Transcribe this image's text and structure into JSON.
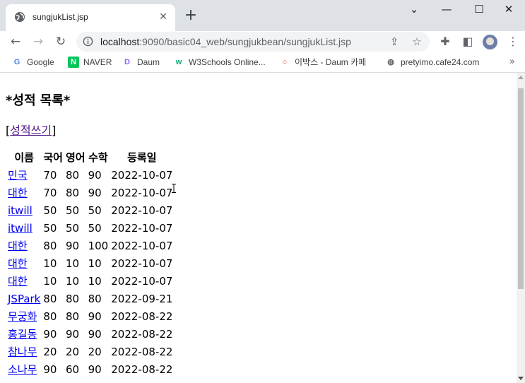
{
  "tab": {
    "title": "sungjukList.jsp",
    "close": "✕"
  },
  "new_tab": "+",
  "window_controls": {
    "minimize": "⌄",
    "restore": "—",
    "maximize": "☐",
    "close": "✕"
  },
  "omnibox": {
    "host": "localhost",
    "path": ":9090/basic04_web/sungjukbean/sungjukList.jsp"
  },
  "bookmarks": [
    {
      "label": "Google",
      "icon": "G",
      "color": "#4285f4"
    },
    {
      "label": "NAVER",
      "icon": "N",
      "color": "#03c75a"
    },
    {
      "label": "Daum",
      "icon": "D",
      "color": "#8a63ff"
    },
    {
      "label": "W3Schools Online...",
      "icon": "w",
      "color": "#04aa6d"
    },
    {
      "label": "이박스 - Daum 카페",
      "icon": "○",
      "color": "#e53935"
    },
    {
      "label": "pretyimo.cafe24.com",
      "icon": "◍",
      "color": "#5f6368"
    }
  ],
  "bookmarks_more": "»",
  "page": {
    "heading": "*성적 목록*",
    "write_link": {
      "open": "[",
      "label": "성적쓰기",
      "close": "]"
    },
    "columns": [
      "이름",
      "국어",
      "영어",
      "수학",
      "등록일"
    ],
    "rows": [
      [
        "민국",
        "70",
        "80",
        "90",
        "2022-10-07"
      ],
      [
        "대한",
        "70",
        "80",
        "90",
        "2022-10-07"
      ],
      [
        "itwill",
        "50",
        "50",
        "50",
        "2022-10-07"
      ],
      [
        "itwill",
        "50",
        "50",
        "50",
        "2022-10-07"
      ],
      [
        "대한",
        "80",
        "90",
        "100",
        "2022-10-07"
      ],
      [
        "대한",
        "10",
        "10",
        "10",
        "2022-10-07"
      ],
      [
        "대한",
        "10",
        "10",
        "10",
        "2022-10-07"
      ],
      [
        "JSPark",
        "80",
        "80",
        "80",
        "2022-09-21"
      ],
      [
        "무궁화",
        "80",
        "80",
        "90",
        "2022-08-22"
      ],
      [
        "홍길동",
        "90",
        "90",
        "90",
        "2022-08-22"
      ],
      [
        "참나무",
        "20",
        "20",
        "20",
        "2022-08-22"
      ],
      [
        "소나무",
        "90",
        "60",
        "90",
        "2022-08-22"
      ],
      [
        "",
        "",
        "",
        "",
        ""
      ]
    ]
  }
}
